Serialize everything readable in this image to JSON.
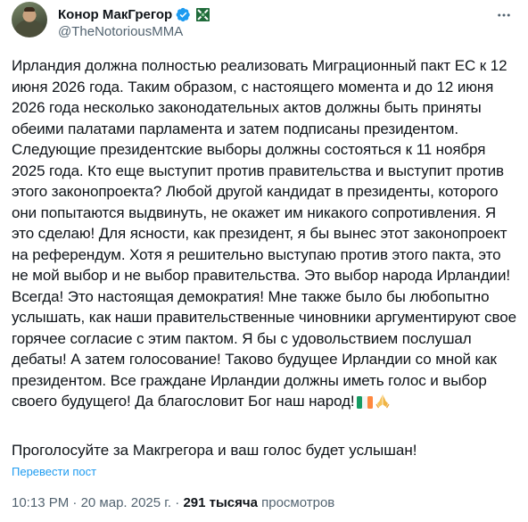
{
  "author": {
    "display_name": "Конор МакГрегор",
    "handle": "@TheNotoriousMMA",
    "avatar_icon": "profile-photo",
    "verified_icon": "verified-badge-icon",
    "affiliation_icon": "irish-flag-badge-icon"
  },
  "more_icon": "three-dots-icon",
  "tweet": {
    "paragraph_1": "Ирландия должна полностью реализовать Миграционный пакт ЕС к 12 июня 2026 года. Таким образом, с настоящего момента и до 12 июня 2026 года несколько законодательных актов должны быть приняты обеими палатами парламента и затем подписаны президентом. Следующие президентские выборы должны состояться к 11 ноября 2025 года. Кто еще выступит против правительства и выступит против этого законопроекта? Любой другой кандидат в президенты, которого они попытаются выдвинуть, не окажет им никакого сопротивления. Я это сделаю! Для ясности, как президент, я бы вынес этот законопроект на референдум. Хотя я решительно выступаю против этого пакта, это не мой выбор и не выбор правительства. Это выбор народа Ирландии! Всегда! Это настоящая демократия! Мне также было бы любопытно услышать, как наши правительственные чиновники аргументируют свое горячее согласие с этим пактом. Я бы с удовольствием послушал дебаты! А затем голосование! Таково будущее Ирландии со мной как президентом. Все граждане Ирландии должны иметь голос и выбор своего будущего! Да благословит Бог наш народ!",
    "emojis": [
      "irish-flag-emoji",
      "praying-hands-emoji"
    ],
    "paragraph_2": "Проголосуйте за Макгрегора и ваш голос будет услышан!"
  },
  "translate_label": "Перевести пост",
  "meta": {
    "time": "10:13 PM",
    "separator": "·",
    "date": "20 мар. 2025 г.",
    "views_count": "291 тысяча",
    "views_label": "просмотров"
  },
  "colors": {
    "text_primary": "#0f1419",
    "text_secondary": "#536471",
    "link": "#1d9bf0",
    "verified": "#1d9bf0",
    "irish_green": "#169b62",
    "irish_orange": "#ff883e"
  }
}
